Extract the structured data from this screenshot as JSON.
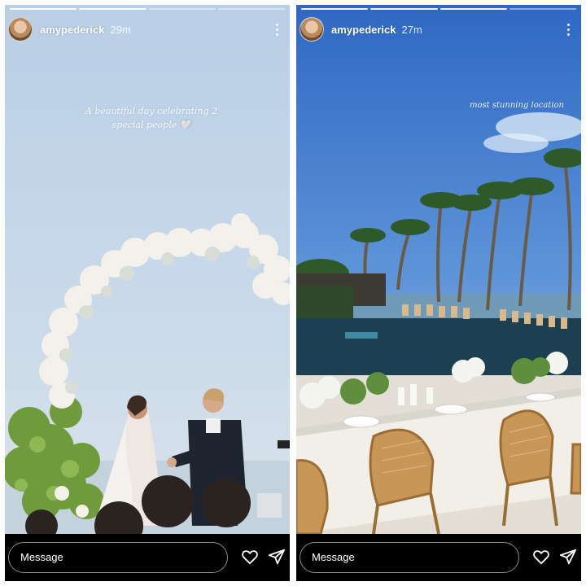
{
  "stories": [
    {
      "username": "amypederick",
      "time": "29m",
      "caption": "A beautiful day celebrating 2 special people 🤍",
      "message_placeholder": "Message",
      "icons": {
        "avatar": "profile-avatar",
        "more": "more-vertical-icon",
        "like": "heart-icon",
        "share": "send-icon"
      }
    },
    {
      "username": "amypederick",
      "time": "27m",
      "caption": "most stunning location",
      "message_placeholder": "Message",
      "icons": {
        "avatar": "profile-avatar",
        "more": "more-vertical-icon",
        "like": "heart-icon",
        "share": "send-icon"
      }
    }
  ],
  "colors": {
    "ui_background": "#000000",
    "text": "#ffffff"
  }
}
